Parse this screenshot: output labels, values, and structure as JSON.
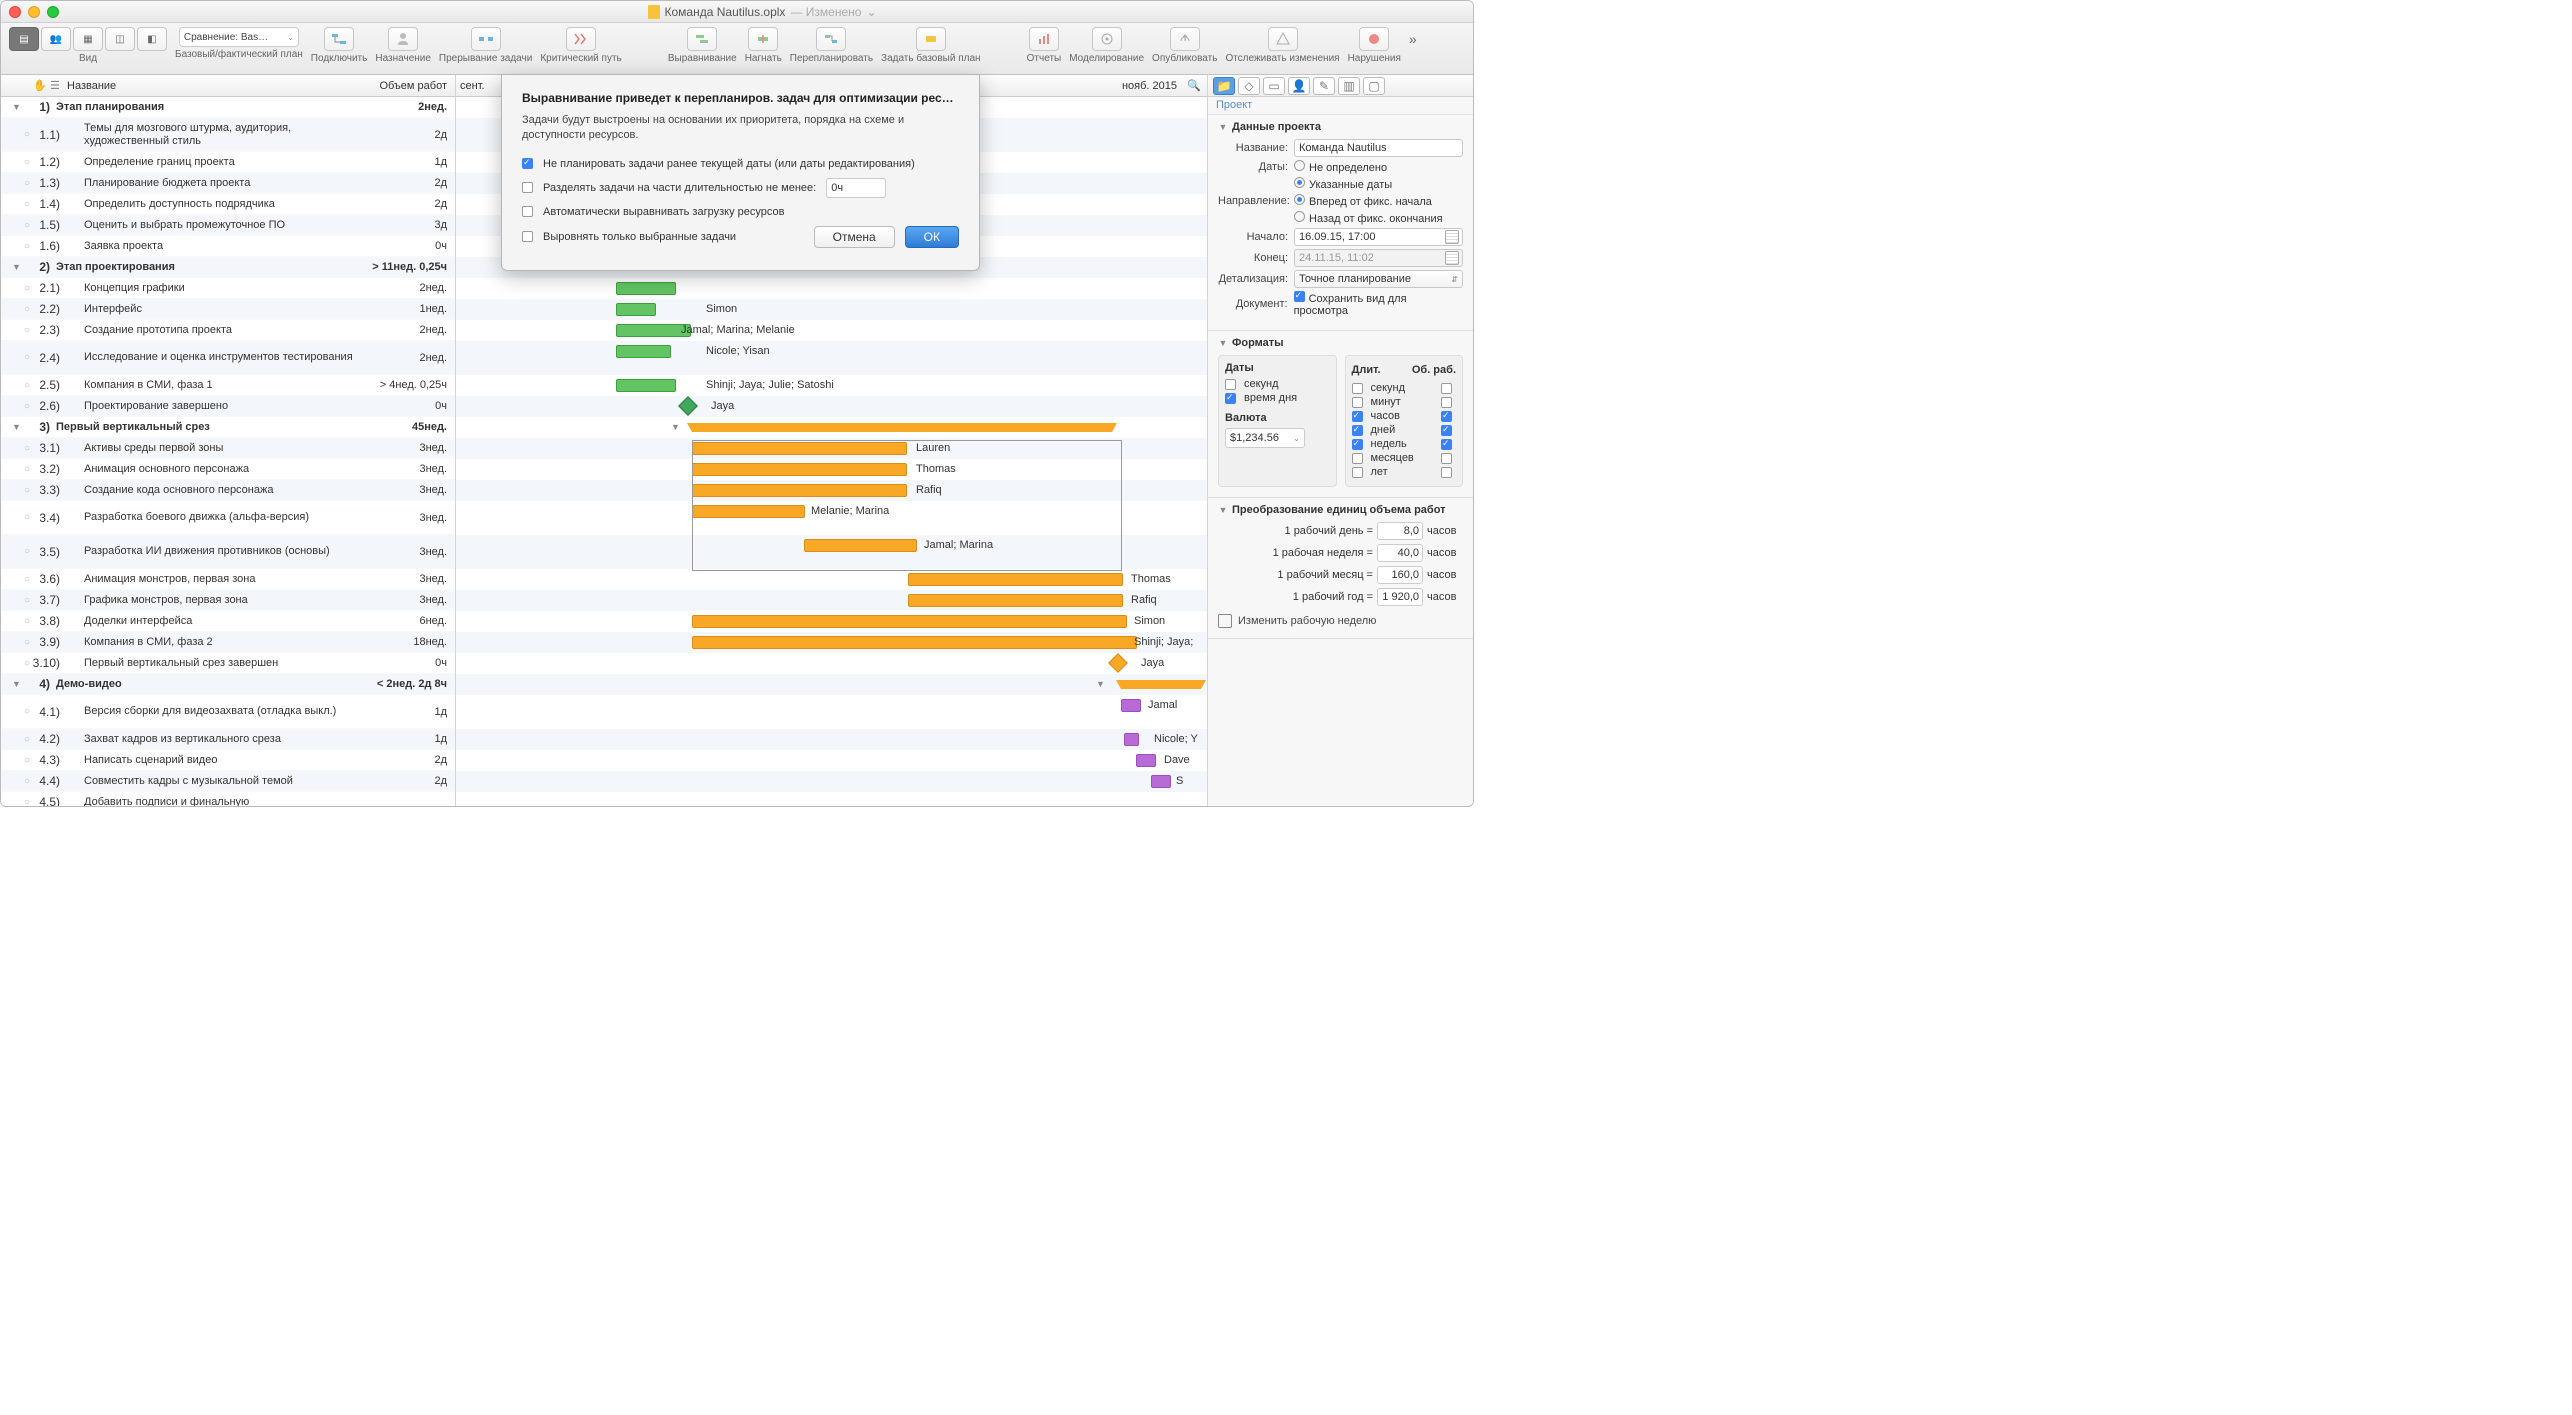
{
  "title": {
    "file": "Команда Nautilus.oplx",
    "changed": "— Изменено",
    "chev": "⌄"
  },
  "toolbar": {
    "view": "Вид",
    "baselineGrp": "Базовый/фактический план",
    "baselineSel": "Сравнение: Bas…",
    "connect": "Подключить",
    "assign": "Назначение",
    "interrupt": "Прерывание задачи",
    "critical": "Критический путь",
    "level": "Выравнивание",
    "catchup": "Нагнать",
    "reschedule": "Перепланировать",
    "setBaseline": "Задать базовый план",
    "reports": "Отчеты",
    "simulate": "Моделирование",
    "publish": "Опубликовать",
    "track": "Отслеживать изменения",
    "violations": "Нарушения"
  },
  "outline": {
    "hand": "✋",
    "name": "Название",
    "effort": "Объем работ"
  },
  "gantt": {
    "m1": "сент.",
    "m2": "нояб. 2015",
    "zoom": "🔍"
  },
  "rows": [
    {
      "grp": true,
      "disc": "▼",
      "idx": "1)",
      "nm": "Этап планирования",
      "eff": "2нед."
    },
    {
      "idx": "1.1)",
      "nm": "Темы для мозгового штурма, аудитория, художественный стиль",
      "eff": "2д",
      "h2": true
    },
    {
      "idx": "1.2)",
      "nm": "Определение границ проекта",
      "eff": "1д"
    },
    {
      "idx": "1.3)",
      "nm": "Планирование бюджета проекта",
      "eff": "2д"
    },
    {
      "idx": "1.4)",
      "nm": "Определить доступность подрядчика",
      "eff": "2д"
    },
    {
      "idx": "1.5)",
      "nm": "Оценить и выбрать промежуточное ПО",
      "eff": "3д"
    },
    {
      "idx": "1.6)",
      "nm": "Заявка проекта",
      "eff": "0ч"
    },
    {
      "grp": true,
      "disc": "▼",
      "idx": "2)",
      "nm": "Этап проектирования",
      "eff": "> 11нед. 0,25ч"
    },
    {
      "idx": "2.1)",
      "nm": "Концепция графики",
      "eff": "2нед."
    },
    {
      "idx": "2.2)",
      "nm": "Интерфейс",
      "eff": "1нед."
    },
    {
      "idx": "2.3)",
      "nm": "Создание прототипа проекта",
      "eff": "2нед."
    },
    {
      "idx": "2.4)",
      "nm": "Исследование и оценка инструментов тестирования",
      "eff": "2нед.",
      "h2": true
    },
    {
      "idx": "2.5)",
      "nm": "Компания в СМИ, фаза 1",
      "eff": "> 4нед. 0,25ч"
    },
    {
      "idx": "2.6)",
      "nm": "Проектирование завершено",
      "eff": "0ч"
    },
    {
      "grp": true,
      "disc": "▼",
      "idx": "3)",
      "nm": "Первый вертикальный срез",
      "eff": "45нед."
    },
    {
      "idx": "3.1)",
      "nm": "Активы среды первой зоны",
      "eff": "3нед."
    },
    {
      "idx": "3.2)",
      "nm": "Анимация основного персонажа",
      "eff": "3нед."
    },
    {
      "idx": "3.3)",
      "nm": "Создание кода основного персонажа",
      "eff": "3нед."
    },
    {
      "idx": "3.4)",
      "nm": "Разработка боевого движка (альфа-версия)",
      "eff": "3нед.",
      "h2": true
    },
    {
      "idx": "3.5)",
      "nm": "Разработка ИИ движения противников (основы)",
      "eff": "3нед.",
      "h2": true
    },
    {
      "idx": "3.6)",
      "nm": "Анимация монстров, первая зона",
      "eff": "3нед."
    },
    {
      "idx": "3.7)",
      "nm": "Графика монстров, первая зона",
      "eff": "3нед."
    },
    {
      "idx": "3.8)",
      "nm": "Доделки интерфейса",
      "eff": "6нед."
    },
    {
      "idx": "3.9)",
      "nm": "Компания в СМИ, фаза 2",
      "eff": "18нед."
    },
    {
      "idx": "3.10)",
      "nm": "Первый вертикальный срез завершен",
      "eff": "0ч"
    },
    {
      "grp": true,
      "disc": "▼",
      "idx": "4)",
      "nm": "Демо-видео",
      "eff": "< 2нед. 2д 8ч"
    },
    {
      "idx": "4.1)",
      "nm": "Версия сборки для видеозахвата (отладка выкл.)",
      "eff": "1д",
      "h2": true
    },
    {
      "idx": "4.2)",
      "nm": "Захват кадров из вертикального среза",
      "eff": "1д"
    },
    {
      "idx": "4.3)",
      "nm": "Написать сценарий видео",
      "eff": "2д"
    },
    {
      "idx": "4.4)",
      "nm": "Совместить кадры с музыкальной темой",
      "eff": "2д"
    },
    {
      "idx": "4.5)",
      "nm": "Добавить подписи и финальную",
      "eff": ""
    }
  ],
  "ganttLabels": {
    "r9": "Simon",
    "r10": "Jamal; Marina; Melanie",
    "r11": "Nicole; Yisan",
    "r12": "Shinji; Jaya; Julie; Satoshi",
    "r13": "Jaya",
    "r15": "Lauren",
    "r16": "Thomas",
    "r17": "Rafiq",
    "r18": "Melanie; Marina",
    "r19": "Jamal; Marina",
    "r20": "Thomas",
    "r21": "Rafiq",
    "r22": "Simon",
    "r23": "Shinji; Jaya;",
    "r24": "Jaya",
    "r26": "Jamal",
    "r27": "Nicole; Y",
    "r28": "Dave",
    "r29": "S"
  },
  "inspector": {
    "tab": "Проект",
    "sec1": "Данные проекта",
    "nameLbl": "Название:",
    "nameVal": "Команда Nautilus",
    "datesLbl": "Даты:",
    "dOpt1": "Не определено",
    "dOpt2": "Указанные даты",
    "dirLbl": "Направление:",
    "dirOpt1": "Вперед от фикс. начала",
    "dirOpt2": "Назад от фикс. окончания",
    "startLbl": "Начало:",
    "startVal": "16.09.15, 17:00",
    "endLbl": "Конец:",
    "endVal": "24.11.15, 11:02",
    "detailLbl": "Детализация:",
    "detailVal": "Точное планирование",
    "docLbl": "Документ:",
    "docChk": "Сохранить вид для просмотра",
    "sec2": "Форматы",
    "fDates": "Даты",
    "fDur": "Длит.",
    "fEff": "Об. раб.",
    "u_sec": "секунд",
    "u_tod": "время дня",
    "u_min": "минут",
    "u_hr": "часов",
    "u_day": "дней",
    "u_wk": "недель",
    "u_mo": "месяцев",
    "u_yr": "лет",
    "curLbl": "Валюта",
    "curVal": "$1,234.56",
    "sec3": "Преобразование единиц объема работ",
    "c1": "1 рабочий день =",
    "c1v": "8,0",
    "c2": "1 рабочая неделя =",
    "c2v": "40,0",
    "c3": "1 рабочий месяц =",
    "c3v": "160,0",
    "c4": "1 рабочий год =",
    "c4v": "1 920,0",
    "cu": "часов",
    "changeWeek": "Изменить рабочую неделю"
  },
  "dialog": {
    "h": "Выравнивание приведет к перепланиров. задач для оптимизации рес…",
    "txt": "Задачи будут выстроены на основании их приоритета, порядка на схеме и доступности ресурсов.",
    "o1": "Не планировать задачи ранее текущей даты (или даты редактирования)",
    "o2": "Разделять задачи на части длительностью не менее:",
    "o2v": "0ч",
    "o3": "Автоматически выравнивать загрузку ресурсов",
    "o4": "Выровнять только выбранные задачи",
    "cancel": "Отмена",
    "ok": "ОК"
  }
}
